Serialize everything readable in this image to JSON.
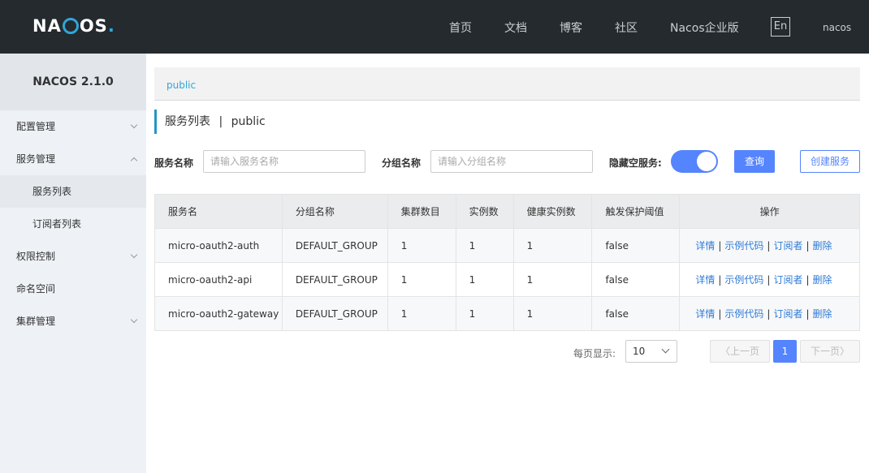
{
  "header": {
    "logo_text_pre": "NA",
    "logo_text_post": "OS",
    "logo_dot": ".",
    "nav": [
      "首页",
      "文档",
      "博客",
      "社区",
      "Nacos企业版"
    ],
    "lang": "En",
    "user": "nacos"
  },
  "sidebar": {
    "version": "NACOS 2.1.0",
    "items": [
      {
        "label": "配置管理"
      },
      {
        "label": "服务管理"
      },
      {
        "label": "服务列表"
      },
      {
        "label": "订阅者列表"
      },
      {
        "label": "权限控制"
      },
      {
        "label": "命名空间"
      },
      {
        "label": "集群管理"
      }
    ]
  },
  "main": {
    "breadcrumb": "public",
    "title": "服务列表",
    "title_sep": "|",
    "namespace": "public",
    "filters": {
      "service_name_label": "服务名称",
      "service_name_placeholder": "请输入服务名称",
      "group_name_label": "分组名称",
      "group_name_placeholder": "请输入分组名称",
      "hide_empty_label": "隐藏空服务:",
      "hide_empty_on": true,
      "query_button": "查询",
      "create_button": "创建服务"
    },
    "table": {
      "columns": [
        "服务名",
        "分组名称",
        "集群数目",
        "实例数",
        "健康实例数",
        "触发保护阈值",
        "操作"
      ],
      "rows": [
        {
          "name": "micro-oauth2-auth",
          "group": "DEFAULT_GROUP",
          "clusters": "1",
          "instances": "1",
          "healthy": "1",
          "threshold": "false"
        },
        {
          "name": "micro-oauth2-api",
          "group": "DEFAULT_GROUP",
          "clusters": "1",
          "instances": "1",
          "healthy": "1",
          "threshold": "false"
        },
        {
          "name": "micro-oauth2-gateway",
          "group": "DEFAULT_GROUP",
          "clusters": "1",
          "instances": "1",
          "healthy": "1",
          "threshold": "false"
        }
      ],
      "actions": {
        "detail": "详情",
        "sample": "示例代码",
        "subscriber": "订阅者",
        "delete": "删除",
        "sep": "|"
      }
    },
    "pagination": {
      "per_page_label": "每页显示:",
      "per_page_value": "10",
      "prev": "上一页",
      "next": "下一页",
      "current_page": "1"
    }
  },
  "colors": {
    "topbar": "#252a2f",
    "accent": "#5584ff",
    "link": "#2f7bd8",
    "breadcrumb": "#2fa7d8"
  }
}
